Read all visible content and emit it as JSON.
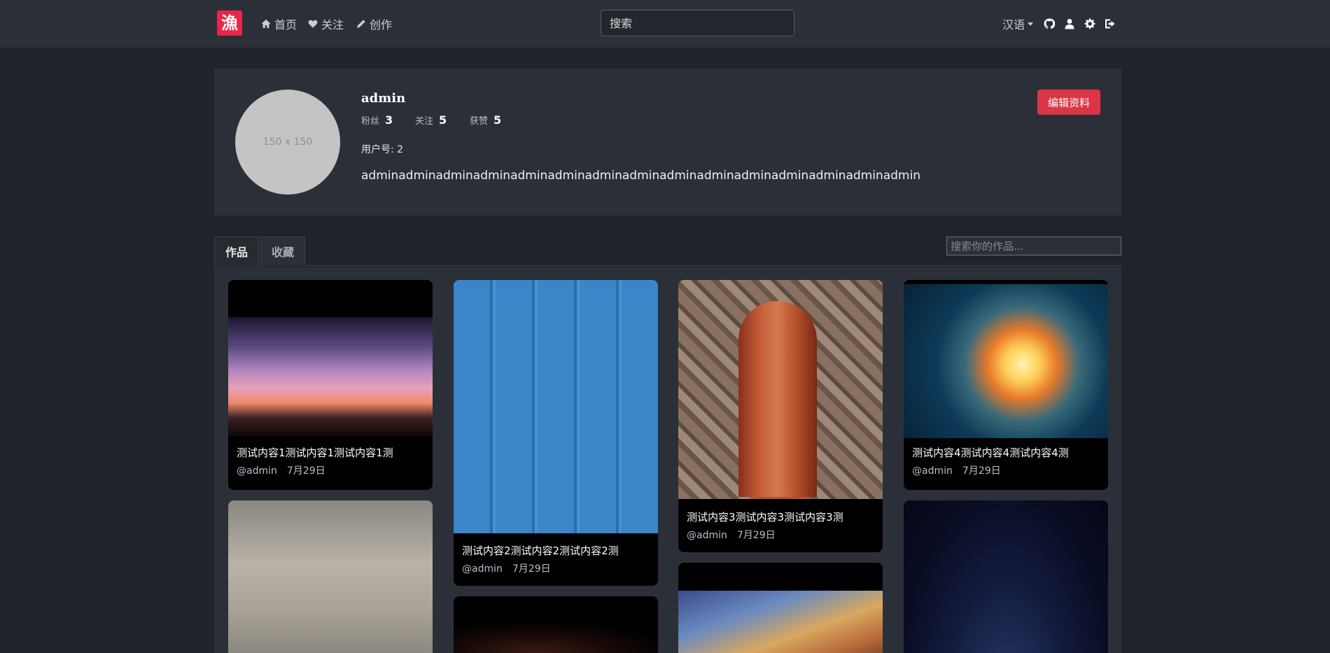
{
  "navbar": {
    "logo_text": "漁",
    "links": [
      {
        "label": "首页",
        "icon": "home-icon"
      },
      {
        "label": "关注",
        "icon": "heart-icon"
      },
      {
        "label": "创作",
        "icon": "pencil-icon"
      }
    ],
    "search_placeholder": "搜索",
    "language": "汉语",
    "icons": [
      "github-icon",
      "user-icon",
      "gear-icon",
      "sign-out-icon"
    ]
  },
  "profile": {
    "avatar_text": "150 x 150",
    "username": "admin",
    "stats": [
      {
        "label": "粉丝",
        "value": "3"
      },
      {
        "label": "关注",
        "value": "5"
      },
      {
        "label": "获赞",
        "value": "5"
      }
    ],
    "user_id": "用户号: 2",
    "bio": "adminadminadminadminadminadminadminadminadminadminadminadminadminadminadmin",
    "edit_button": "编辑资料"
  },
  "tabs": {
    "items": [
      "作品",
      "收藏"
    ],
    "active": "作品",
    "search_placeholder": "搜索你的作品..."
  },
  "works": [
    {
      "title": "测试内容1测试内容1测试内容1测",
      "author": "@admin",
      "date": "7月29日"
    },
    {
      "title": "测试内容2测试内容2测试内容2测",
      "author": "@admin",
      "date": "7月29日"
    },
    {
      "title": "测试内容3测试内容3测试内容3测",
      "author": "@admin",
      "date": "7月29日"
    },
    {
      "title": "测试内容4测试内容4测试内容4测",
      "author": "@admin",
      "date": "7月29日"
    }
  ],
  "colors": {
    "background": "#1f232a",
    "panel": "#2b3038",
    "accent_red": "#dc3545",
    "logo_red": "#e8264a"
  }
}
